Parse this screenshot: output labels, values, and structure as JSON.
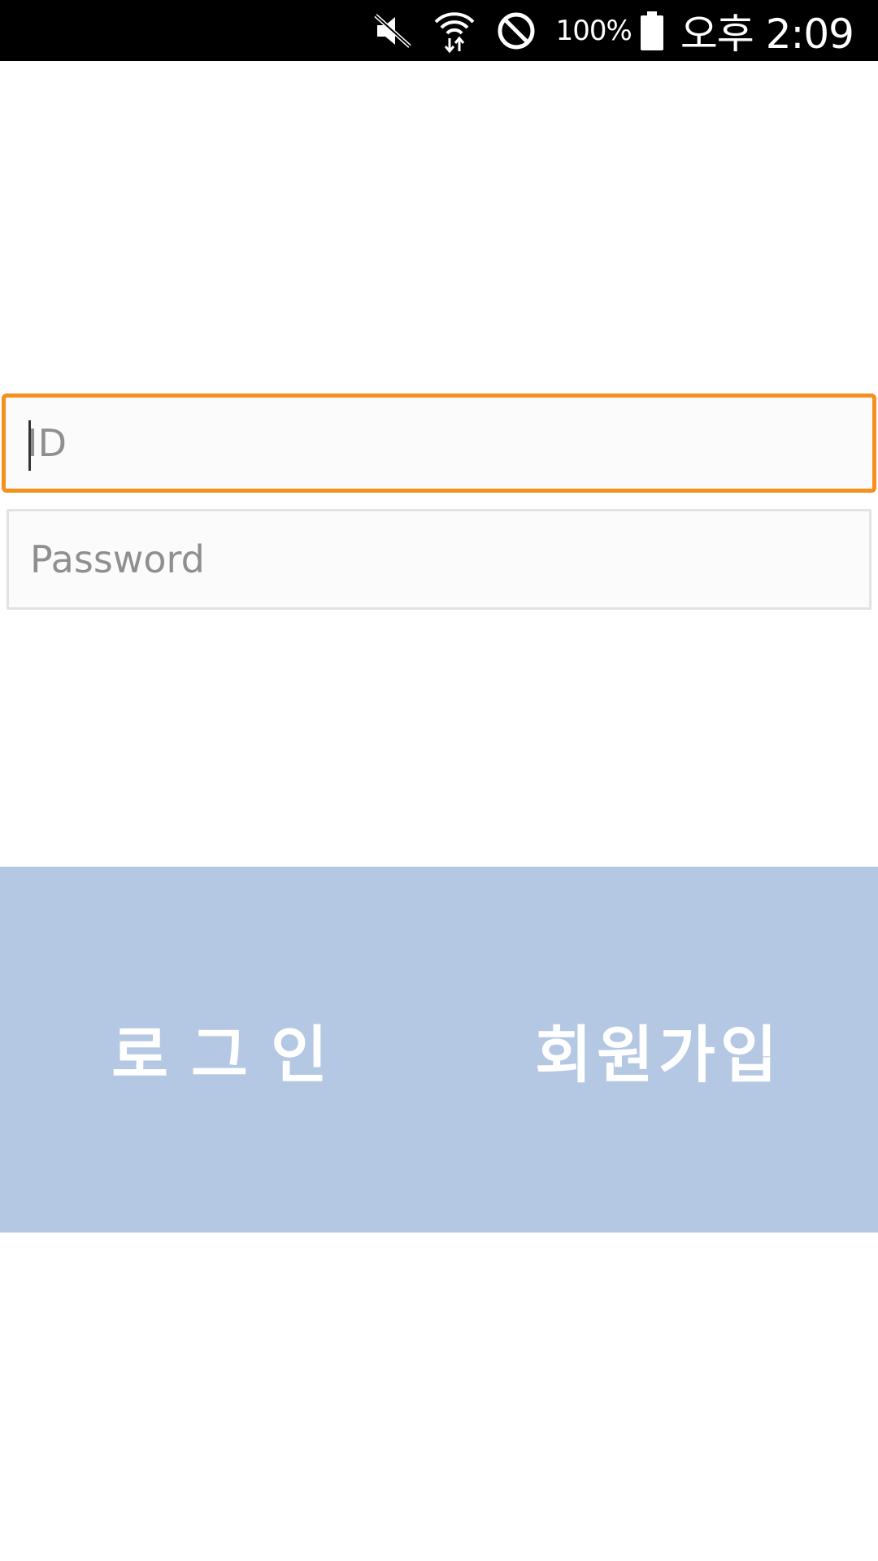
{
  "status_bar": {
    "battery_percent": "100%",
    "time": "오후 2:09",
    "icons": [
      "mute-icon",
      "wifi-icon",
      "block-icon",
      "battery-icon"
    ]
  },
  "login_form": {
    "id_placeholder": "ID",
    "id_value": "",
    "password_placeholder": "Password",
    "password_value": ""
  },
  "buttons": {
    "login_label": "로그인",
    "signup_label": "회원가입"
  },
  "colors": {
    "focus_border": "#f5901e",
    "panel_background": "#b4c8e3"
  }
}
